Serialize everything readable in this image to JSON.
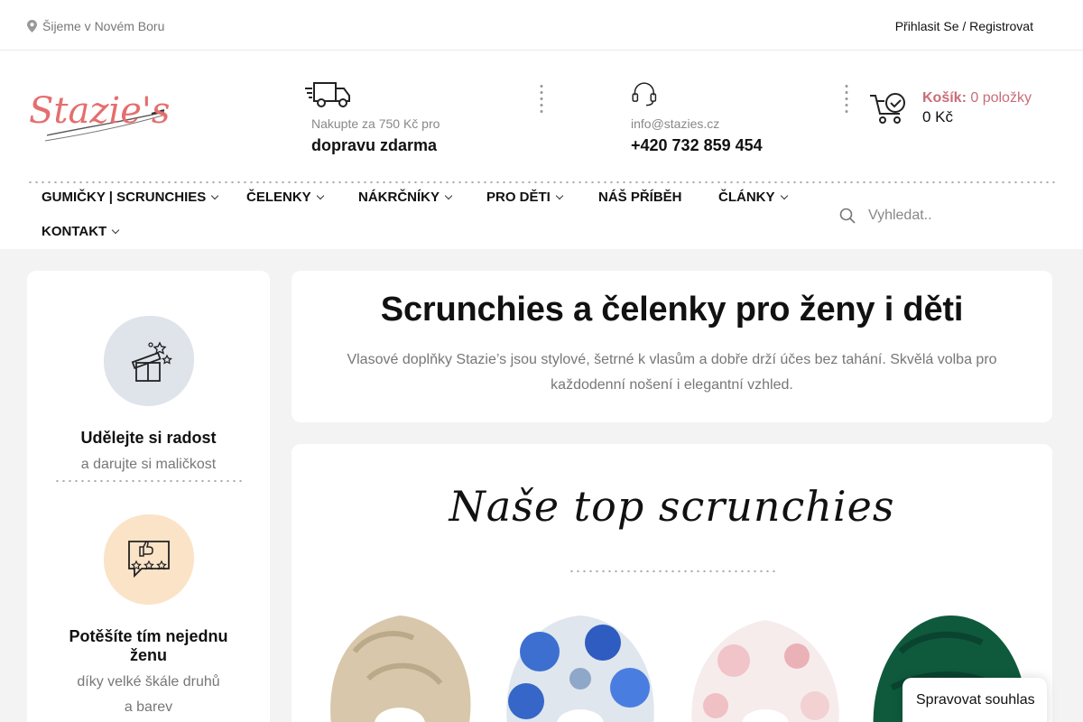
{
  "topbar": {
    "location": "Šijeme v Novém Boru",
    "login": "Přihlasit Se / Registrovat"
  },
  "header": {
    "logo_text": "Stazie's",
    "shipping": {
      "small": "Nakupte za 750 Kč pro",
      "big": "dopravu zdarma",
      "icon": "truck-icon"
    },
    "contact": {
      "small": "info@stazies.cz",
      "big": "+420 732 859 454",
      "icon": "headset-icon"
    },
    "cart": {
      "label": "Košík:",
      "count": "0 položky",
      "price": "0 Kč",
      "icon": "cart-icon"
    }
  },
  "nav": {
    "items": [
      {
        "label": "GUMIČKY | SCRUNCHIES",
        "dropdown": true
      },
      {
        "label": "ČELENKY",
        "dropdown": true
      },
      {
        "label": "NÁKRČNÍKY",
        "dropdown": true
      },
      {
        "label": "PRO DĚTI",
        "dropdown": true
      },
      {
        "label": "NÁŠ PŘÍBĚH",
        "dropdown": false
      },
      {
        "label": "ČLÁNKY",
        "dropdown": true
      },
      {
        "label": "KONTAKT",
        "dropdown": true
      }
    ]
  },
  "search": {
    "placeholder": "Vyhledat.."
  },
  "sidebar": {
    "features": [
      {
        "title": "Udělejte si radost",
        "subtitle": "a darujte si maličkost",
        "icon": "gift-icon",
        "color": "#dfe3ea"
      },
      {
        "title": "Potěšíte tím nejednu ženu",
        "subtitle": "díky velké škále druhů a barev",
        "icon": "rating-icon",
        "color": "#fbe3c8"
      }
    ]
  },
  "hero": {
    "title": "Scrunchies a čelenky pro ženy i děti",
    "description": "Vlasové doplňky Stazie’s jsou stylové, šetrné k vlasům a dobře drží účes bez tahání. Skvělá volba pro každodenní nošení i elegantní vzhled."
  },
  "products": {
    "heading": "Naše top scrunchies",
    "items": [
      {
        "name": "beige-satin",
        "color": "#d8c7ab"
      },
      {
        "name": "blue-floral",
        "color": "#3c6fd0"
      },
      {
        "name": "pink-floral",
        "color": "#f3e0e0"
      },
      {
        "name": "green-satin",
        "color": "#0f5a3d"
      }
    ]
  },
  "consent": {
    "label": "Spravovat souhlas"
  },
  "colors": {
    "accent": "#c96d77",
    "muted": "#777777"
  }
}
